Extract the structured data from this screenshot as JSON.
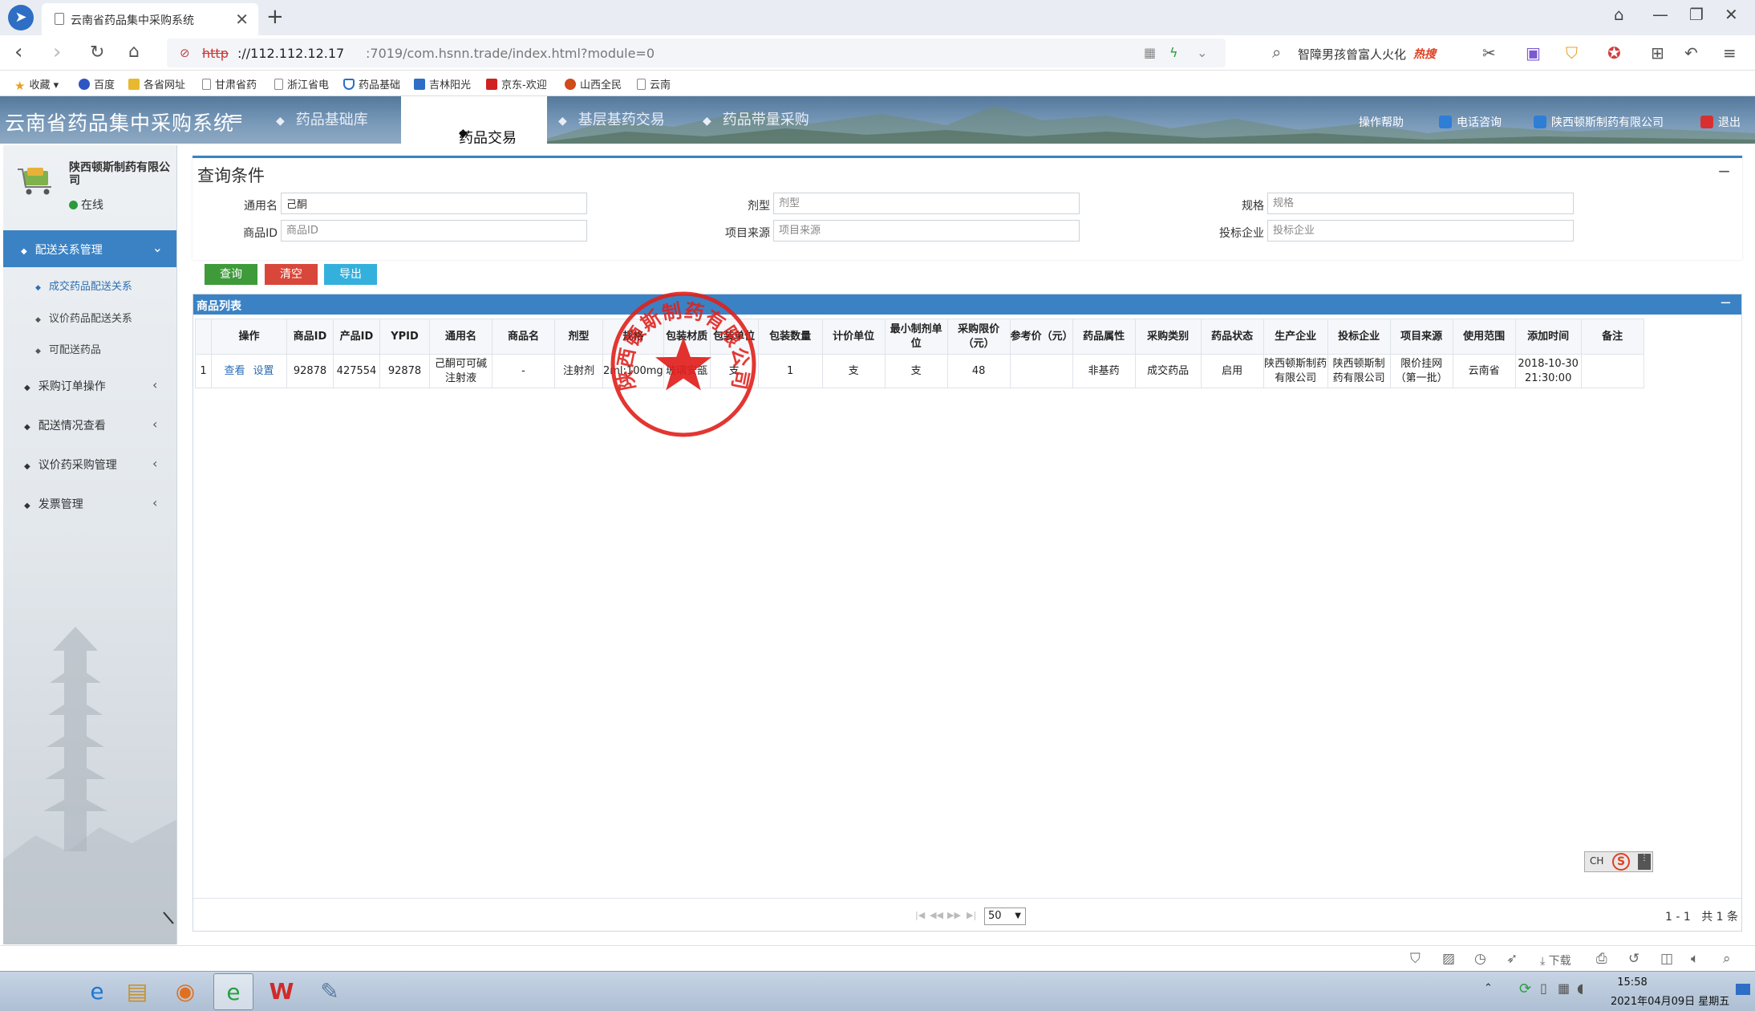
{
  "browser": {
    "tab_title": "云南省药品集中采购系统",
    "url_scheme": "http",
    "url_host": "://112.112.12.17",
    "url_path": ":7019/com.hsnn.trade/index.html?module=0",
    "search_text": "智障男孩曾富人火化",
    "search_hot": "热搜"
  },
  "bookmarks": [
    {
      "label": "收藏",
      "icon": "star-icon"
    },
    {
      "label": "百度",
      "icon": "baidu-icon"
    },
    {
      "label": "各省网址",
      "icon": "folder-icon"
    },
    {
      "label": "甘肃省药",
      "icon": "page-icon"
    },
    {
      "label": "浙江省电",
      "icon": "page-icon"
    },
    {
      "label": "药品基础",
      "icon": "shield-icon"
    },
    {
      "label": "吉林阳光",
      "icon": "check-icon"
    },
    {
      "label": "京东-欢迎",
      "icon": "jd-icon"
    },
    {
      "label": "山西全民",
      "icon": "circle-icon"
    },
    {
      "label": "云南",
      "icon": "page-icon"
    }
  ],
  "header": {
    "app_title": "云南省药品集中采购系统",
    "nav": [
      "药品基础库",
      "药品交易",
      "基层基药交易",
      "药品带量采购"
    ],
    "active_nav": "药品交易",
    "help": "操作帮助",
    "phone": "电话咨询",
    "company": "陕西顿斯制药有限公司",
    "logout": "退出"
  },
  "sidebar": {
    "user_name": "陕西顿斯制药有限公司",
    "status": "在线",
    "active_group": "配送关系管理",
    "sub_items": [
      "成交药品配送关系",
      "议价药品配送关系",
      "可配送药品"
    ],
    "groups": [
      "采购订单操作",
      "配送情况查看",
      "议价药采购管理",
      "发票管理"
    ]
  },
  "query": {
    "title": "查询条件",
    "fields": [
      {
        "label": "通用名",
        "value": "己酮",
        "placeholder": "通用名"
      },
      {
        "label": "剂型",
        "value": "",
        "placeholder": "剂型"
      },
      {
        "label": "规格",
        "value": "",
        "placeholder": "规格"
      },
      {
        "label": "商品ID",
        "value": "",
        "placeholder": "商品ID"
      },
      {
        "label": "项目来源",
        "value": "",
        "placeholder": "项目来源"
      },
      {
        "label": "投标企业",
        "value": "",
        "placeholder": "投标企业"
      }
    ],
    "buttons": {
      "search": "查询",
      "clear": "清空",
      "export": "导出"
    },
    "colors": {
      "search": "#3f9a3a",
      "clear": "#d9473a",
      "export": "#34b0dc"
    }
  },
  "result": {
    "title": "商品列表",
    "columns": [
      "",
      "操作",
      "商品ID",
      "产品ID",
      "YPID",
      "通用名",
      "商品名",
      "剂型",
      "规格",
      "包装材质",
      "包装单位",
      "包装数量",
      "计价单位",
      "最小制剂单位",
      "采购限价（元）",
      "参考价（元）",
      "药品属性",
      "采购类别",
      "药品状态",
      "生产企业",
      "投标企业",
      "项目来源",
      "使用范围",
      "添加时间",
      "备注"
    ],
    "rows": [
      {
        "no": "1",
        "actions": [
          "查看",
          "设置"
        ],
        "cells": [
          "92878",
          "427554",
          "92878",
          "己酮可可碱注射液",
          "-",
          "注射剂",
          "2ml:100mg",
          "玻璃安瓿",
          "支",
          "1",
          "支",
          "支",
          "48",
          "",
          "非基药",
          "成交药品",
          "启用",
          "陕西顿斯制药有限公司",
          "陕西顿斯制药有限公司",
          "限价挂网（第一批）",
          "云南省",
          "2018-10-30 21:30:00",
          ""
        ]
      }
    ],
    "page_size": "50",
    "range": "1 - 1",
    "total": "共 1 条"
  },
  "stamp": {
    "text": "陕西顿斯制药有限公司",
    "color": "#e0201c"
  },
  "ime": {
    "mode": "CH",
    "brand": "S"
  },
  "statusbar": {
    "download": "下载"
  },
  "clock": {
    "time": "15:58",
    "date": "2021年04月09日 星期五"
  }
}
